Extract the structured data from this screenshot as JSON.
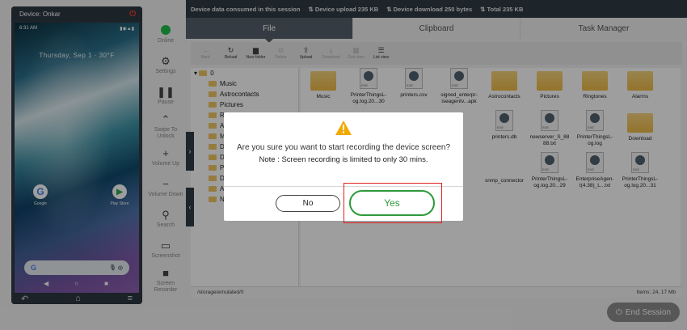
{
  "phone": {
    "device_label": "Device: Onkar",
    "status_time": "6:31 AM",
    "date_text": "Thursday, Sep 1 · 30°F",
    "apps": [
      {
        "label": "Google"
      },
      {
        "label": "Play Store"
      }
    ]
  },
  "sidebar": {
    "items": [
      {
        "label": "Online",
        "icon": "online-status-dot"
      },
      {
        "label": "Settings",
        "icon": "gear-icon"
      },
      {
        "label": "Pause",
        "icon": "pause-icon"
      },
      {
        "label": "Swipe To Unlock",
        "icon": "swipe-up-icon"
      },
      {
        "label": "Volume Up",
        "icon": "plus-icon"
      },
      {
        "label": "Volume Down",
        "icon": "minus-icon"
      },
      {
        "label": "Search",
        "icon": "search-icon"
      },
      {
        "label": "Screenshot",
        "icon": "monitor-icon"
      },
      {
        "label": "Screen Recorder",
        "icon": "video-camera-icon"
      }
    ]
  },
  "info": {
    "session_label": "Device data consumed in this session",
    "upload": "Device upload 235 KB",
    "download": "Device download 250 bytes",
    "total": "Total 235 KB"
  },
  "tabs": [
    "File",
    "Clipboard",
    "Task Manager"
  ],
  "toolbar": [
    "Back",
    "Reload",
    "New folder",
    "Delete",
    "Upload",
    "Download",
    "Grid view",
    "List view"
  ],
  "tree": {
    "root": "0",
    "items": [
      "Music",
      "Astrocontacts",
      "Pictures",
      "Ri",
      "Al",
      "Mi",
      "DC",
      "Do",
      "Po",
      "Do",
      "An",
      "No"
    ]
  },
  "files": [
    {
      "name": "Music",
      "kind": "folder"
    },
    {
      "name": "PrinterThingsL-og.log.20...30",
      "kind": "file"
    },
    {
      "name": "printers.csv",
      "kind": "file"
    },
    {
      "name": "signed_enterpr-iseagentv...apk",
      "kind": "file"
    },
    {
      "name": "Astrocontacts",
      "kind": "folder"
    },
    {
      "name": "Pictures",
      "kind": "folder"
    },
    {
      "name": "Ringtones",
      "kind": "folder"
    },
    {
      "name": "Alarms",
      "kind": "folder"
    },
    {
      "name": "printers.db",
      "kind": "file"
    },
    {
      "name": "newserver_S_88 88.txt",
      "kind": "file"
    },
    {
      "name": "PrinterThingsL-og.log",
      "kind": "file"
    },
    {
      "name": "Download",
      "kind": "folder"
    },
    {
      "name": "ons",
      "kind": "text"
    },
    {
      "name": "snmp_connector",
      "kind": "text"
    },
    {
      "name": "PrinterThingsL-og.log.20...29",
      "kind": "file"
    },
    {
      "name": "EnterpriseAgen-t(4.38)_L...txt",
      "kind": "file"
    },
    {
      "name": "PrinterThingsL-og.log.20...31",
      "kind": "file"
    }
  ],
  "pathbar": {
    "path": "/storage/emulated/0",
    "summary": "Items: 24, 17 Mb"
  },
  "end_session": "End Session",
  "dialog": {
    "message": "Are you sure you want to start recording the device screen?",
    "note": "Note : Screen recording is limited to only 30 mins.",
    "no_label": "No",
    "yes_label": "Yes"
  }
}
